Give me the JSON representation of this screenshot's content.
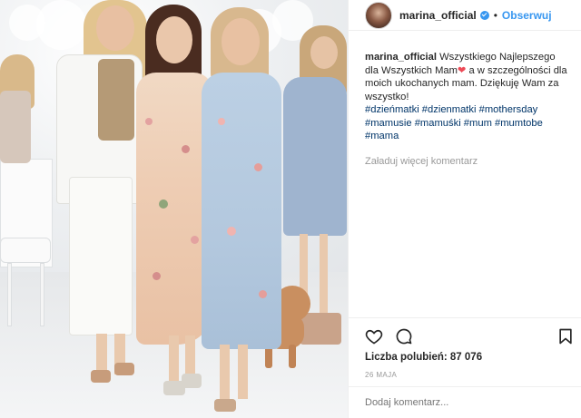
{
  "post": {
    "photo_alt": "Photo",
    "header": {
      "username": "marina_official",
      "separator": "•",
      "follow_label": "Obserwuj"
    },
    "caption": {
      "username": "marina_official",
      "text_part1": "Wszystkiego Najlepszego dla Wszystkich Mam",
      "heart": "❤",
      "text_part2": "a w szczególności dla moich ukochanych mam. Dziękuję Wam za wszystko!",
      "hashtags_line1": "#dzieńmatki #dzienmatki #mothersday",
      "hashtags_line2": "#mamusie #mamuśki #mum #mumtobe",
      "hashtags_line3": "#mama"
    },
    "load_more_comments": "Załaduj więcej komentarz",
    "likes": "Liczba polubień: 87 076",
    "date": "26 MAJA",
    "comment_placeholder": "Dodaj komentarz...",
    "icons": {
      "like": "heart-icon",
      "comment": "comment-icon",
      "save": "bookmark-icon"
    },
    "colors": {
      "accent": "#3897f0",
      "hashtag": "#003569",
      "muted": "#999999",
      "heart": "#ed4956"
    }
  }
}
